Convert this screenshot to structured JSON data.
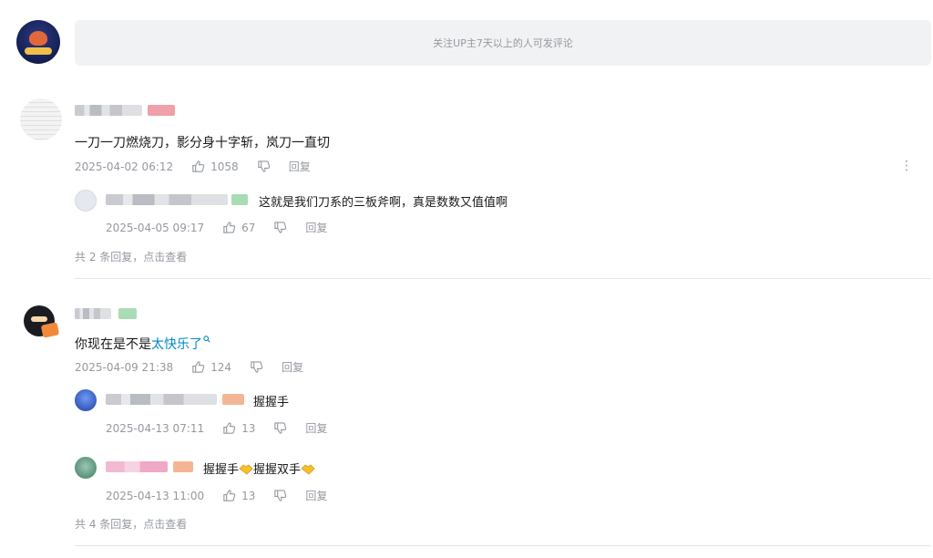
{
  "composer": {
    "notice": "关注UP主7天以上的人可发评论"
  },
  "comments": [
    {
      "text": "一刀一刀燃烧刀，影分身十字斩，岚刀一直切",
      "time": "2025-04-02 06:12",
      "likes": "1058",
      "reply_label": "回复",
      "replies": [
        {
          "text": "这就是我们刀系的三板斧啊，真是数数又值值啊",
          "time": "2025-04-05 09:17",
          "likes": "67",
          "reply_label": "回复"
        }
      ],
      "more_replies": "共 2 条回复，点击查看"
    },
    {
      "text_plain": "你现在是不是",
      "text_link": "太快乐了",
      "time": "2025-04-09 21:38",
      "likes": "124",
      "reply_label": "回复",
      "replies": [
        {
          "text": "握握手",
          "time": "2025-04-13 07:11",
          "likes": "13",
          "reply_label": "回复"
        },
        {
          "text_a": "握握手",
          "text_b": "握握双手",
          "time": "2025-04-13 11:00",
          "likes": "13",
          "reply_label": "回复"
        }
      ],
      "more_replies": "共 4 条回复，点击查看"
    }
  ],
  "colors": {
    "accent_link": "#008ac5",
    "meta": "#9499a0",
    "text": "#18191c",
    "divider": "#e3e5e7"
  },
  "icons": {
    "like": "thumbs-up-icon",
    "dislike": "thumbs-down-icon",
    "more": "more-vertical-icon",
    "search_hint": "search-icon"
  }
}
